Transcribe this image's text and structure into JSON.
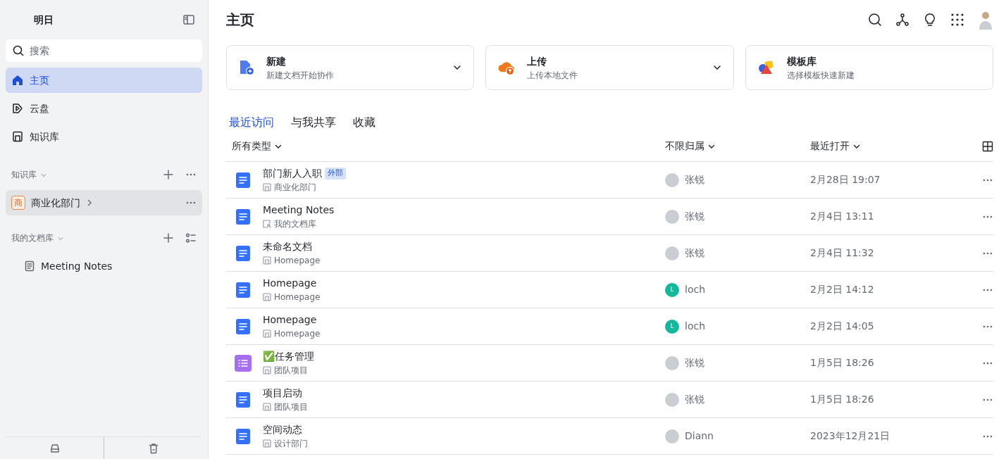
{
  "sidebar": {
    "title": "明日",
    "search": {
      "placeholder": "搜索"
    },
    "nav": [
      {
        "label": "主页",
        "kind": "home",
        "selected": true
      },
      {
        "label": "云盘",
        "kind": "drive",
        "selected": false
      },
      {
        "label": "知识库",
        "kind": "wiki",
        "selected": false
      }
    ],
    "sections": [
      {
        "title": "知识库",
        "kind": "more",
        "items": [
          {
            "label": "商业化部门",
            "badge": "商",
            "kind": "space",
            "highlighted": true
          }
        ]
      },
      {
        "title": "我的文档库",
        "kind": "list",
        "items": [
          {
            "label": "Meeting Notes",
            "kind": "doc",
            "highlighted": false
          }
        ]
      }
    ]
  },
  "main": {
    "title": "主页",
    "cards": [
      {
        "title": "新建",
        "subtitle": "新建文档开始协作",
        "kind": "new",
        "dropdown": true
      },
      {
        "title": "上传",
        "subtitle": "上传本地文件",
        "kind": "upload",
        "dropdown": true
      },
      {
        "title": "模板库",
        "subtitle": "选择模板快速新建",
        "kind": "template",
        "dropdown": false
      }
    ],
    "tabs": [
      {
        "label": "最近访问",
        "selected": true
      },
      {
        "label": "与我共享",
        "selected": false
      },
      {
        "label": "收藏",
        "selected": false
      }
    ],
    "table": {
      "columns": [
        "所有类型",
        "不限归属",
        "最近打开"
      ],
      "rows": [
        {
          "kind": "doc",
          "title": "部门新人入职",
          "tag": "外部",
          "location": {
            "kind": "wiki",
            "text": "商业化部门"
          },
          "owner": {
            "kind": "photo",
            "name": "张锐"
          },
          "opened": "2月28日 19:07"
        },
        {
          "kind": "doc",
          "title": "Meeting Notes",
          "location": {
            "kind": "mylib",
            "text": "我的文档库"
          },
          "owner": {
            "kind": "photo",
            "name": "张锐"
          },
          "opened": "2月4日 13:11"
        },
        {
          "kind": "doc",
          "title": "未命名文档",
          "location": {
            "kind": "wiki",
            "text": "Homepage"
          },
          "owner": {
            "kind": "photo",
            "name": "张锐"
          },
          "opened": "2月4日 11:32"
        },
        {
          "kind": "doc",
          "title": "Homepage",
          "location": {
            "kind": "wiki",
            "text": "Homepage"
          },
          "owner": {
            "kind": "letter",
            "letter": "L",
            "color": "#14b89a",
            "name": "loch"
          },
          "opened": "2月2日 14:12"
        },
        {
          "kind": "doc",
          "title": "Homepage",
          "location": {
            "kind": "wiki",
            "text": "Homepage"
          },
          "owner": {
            "kind": "letter",
            "letter": "L",
            "color": "#14b89a",
            "name": "loch"
          },
          "opened": "2月2日 14:05"
        },
        {
          "kind": "task",
          "title": "✅任务管理",
          "location": {
            "kind": "wiki",
            "text": "团队项目"
          },
          "owner": {
            "kind": "photo",
            "name": "张锐"
          },
          "opened": "1月5日 18:26"
        },
        {
          "kind": "doc",
          "title": "项目启动",
          "location": {
            "kind": "wiki",
            "text": "团队项目"
          },
          "owner": {
            "kind": "photo",
            "name": "张锐"
          },
          "opened": "1月5日 18:26"
        },
        {
          "kind": "doc",
          "title": "空间动态",
          "location": {
            "kind": "wiki",
            "text": "设计部门"
          },
          "owner": {
            "kind": "photo",
            "name": "Diann"
          },
          "opened": "2023年12月21日"
        }
      ]
    }
  }
}
